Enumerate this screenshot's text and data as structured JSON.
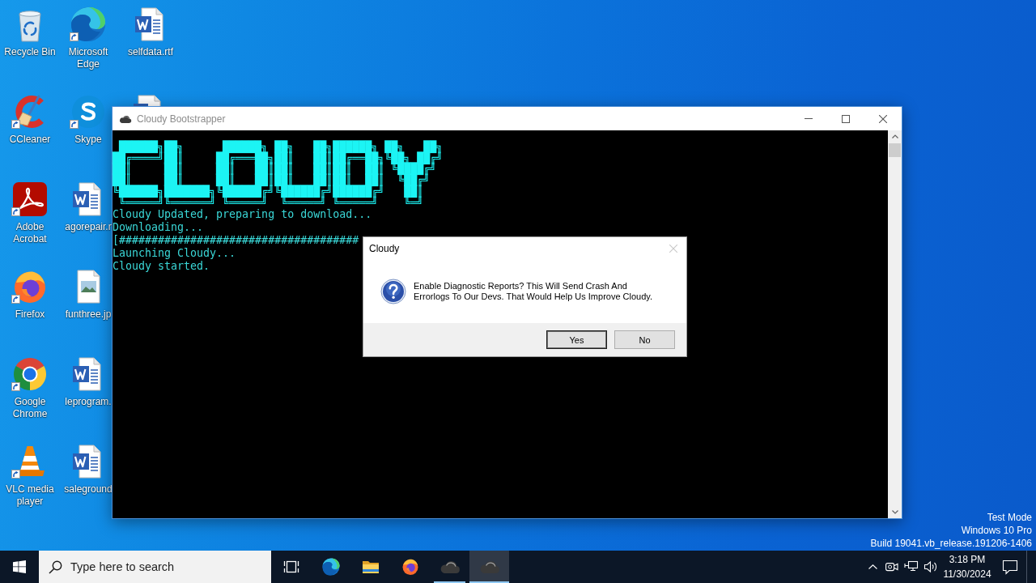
{
  "desktop_icons": [
    {
      "label": "Recycle Bin",
      "shortcut": false
    },
    {
      "label": "CCleaner",
      "shortcut": true
    },
    {
      "label": "Adobe Acrobat",
      "shortcut": true
    },
    {
      "label": "Firefox",
      "shortcut": true
    },
    {
      "label": "Google Chrome",
      "shortcut": true
    },
    {
      "label": "VLC media player",
      "shortcut": true
    },
    {
      "label": "Microsoft Edge",
      "shortcut": true
    },
    {
      "label": "Skype",
      "shortcut": true
    },
    {
      "label": "agorepair.r",
      "shortcut": false
    },
    {
      "label": "funthree.jp",
      "shortcut": false
    },
    {
      "label": "leprogram.",
      "shortcut": false
    },
    {
      "label": "saleground",
      "shortcut": false
    },
    {
      "label": "selfdata.rtf",
      "shortcut": false
    }
  ],
  "console_window": {
    "title": "Cloudy Bootstrapper",
    "banner": [
      " ██████╗██╗      ██████╗ ██╗   ██╗██████╗ ██╗   ██╗",
      "██╔════╝██║     ██╔═══██╗██║   ██║██╔══██╗╚██╗ ██╔╝",
      "██║     ██║     ██║   ██║██║   ██║██║  ██║ ╚████╔╝",
      "██║     ██║     ██║   ██║██║   ██║██║  ██║  ╚██╔╝",
      "╚██████╗███████╗╚██████╔╝╚██████╔╝██████╔╝   ██║",
      " ╚═════╝╚══════╝ ╚═════╝  ╚═════╝ ╚═════╝    ╚═╝"
    ],
    "lines": [
      "Cloudy Updated, preparing to download...",
      "Downloading...",
      "[#####################################",
      "Launching Cloudy...",
      "Cloudy started."
    ]
  },
  "dialog": {
    "title": "Cloudy",
    "close_disabled": true,
    "message": "Enable Diagnostic Reports? This Will Send Crash And Errorlogs To Our Devs. That Would Help Us Improve Cloudy.",
    "buttons": [
      {
        "label": "Yes",
        "focused": true
      },
      {
        "label": "No",
        "focused": false
      }
    ]
  },
  "system_notice": [
    "Test Mode",
    "Windows 10 Pro",
    "Build 19041.vb_release.191206-1406"
  ],
  "taskbar": {
    "search": {
      "placeholder": "Type here to search"
    },
    "apps": [
      {
        "running": false,
        "selected": false
      },
      {
        "running": false,
        "selected": false
      },
      {
        "running": false,
        "selected": false
      },
      {
        "running": true,
        "selected": false
      },
      {
        "running": true,
        "selected": true
      }
    ],
    "clock": {
      "time": "3:18 PM",
      "date": "11/30/2024"
    }
  }
}
